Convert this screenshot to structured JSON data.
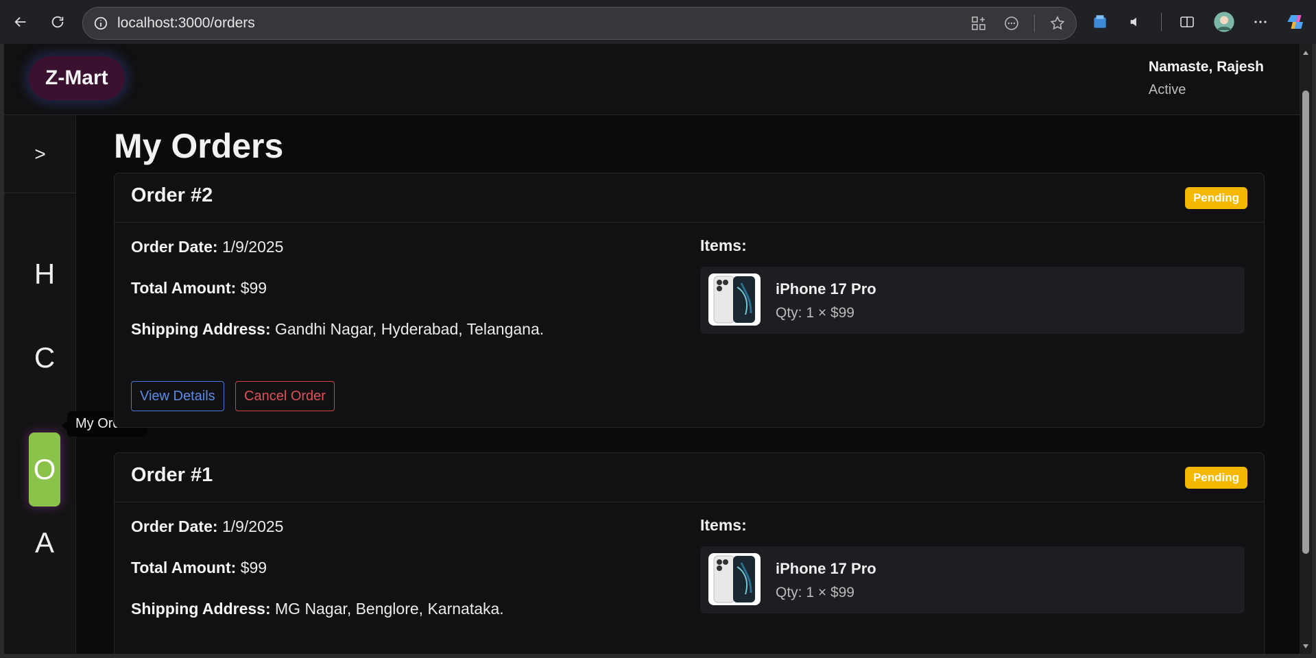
{
  "browser": {
    "url": "localhost:3000/orders"
  },
  "header": {
    "logo": "Z-Mart",
    "greeting": "Namaste, Rajesh",
    "status": "Active"
  },
  "sidebar": {
    "toggle": ">",
    "items": [
      {
        "letter": "H"
      },
      {
        "letter": "C"
      },
      {
        "letter": "O",
        "active": true
      },
      {
        "letter": "A"
      }
    ],
    "tooltip": "My Orders"
  },
  "main": {
    "title": "My Orders",
    "orders": [
      {
        "title": "Order #2",
        "status": "Pending",
        "date_label": "Order Date:",
        "date": "1/9/2025",
        "total_label": "Total Amount:",
        "total": "$99",
        "address_label": "Shipping Address:",
        "address": "Gandhi Nagar, Hyderabad, Telangana.",
        "items_label": "Items:",
        "items": [
          {
            "name": "iPhone 17 Pro",
            "qty": "Qty: 1 × $99"
          }
        ],
        "view_label": "View Details",
        "cancel_label": "Cancel Order"
      },
      {
        "title": "Order #1",
        "status": "Pending",
        "date_label": "Order Date:",
        "date": "1/9/2025",
        "total_label": "Total Amount:",
        "total": "$99",
        "address_label": "Shipping Address:",
        "address": "MG Nagar, Benglore, Karnataka.",
        "items_label": "Items:",
        "items": [
          {
            "name": "iPhone 17 Pro",
            "qty": "Qty: 1 × $99"
          }
        ]
      }
    ]
  },
  "colors": {
    "accent_active": "#8bc34a",
    "badge_pending": "#f5b800",
    "view_button": "#5b8be6",
    "cancel_button": "#e05058"
  }
}
